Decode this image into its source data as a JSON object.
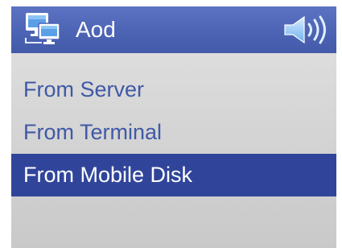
{
  "titlebar": {
    "title": "Aod",
    "app_icon": "network-computers-icon",
    "volume_icon": "speaker-volume-icon"
  },
  "menu": {
    "items": [
      {
        "label": "From Server",
        "selected": false
      },
      {
        "label": "From Terminal",
        "selected": false
      },
      {
        "label": "From Mobile Disk",
        "selected": true
      }
    ]
  },
  "colors": {
    "titlebar": "#4d64b5",
    "menu_text": "#3f59a6",
    "selected_background": "#30459a",
    "selected_text": "#ffffff",
    "screen_background": "#d6d6d6"
  }
}
